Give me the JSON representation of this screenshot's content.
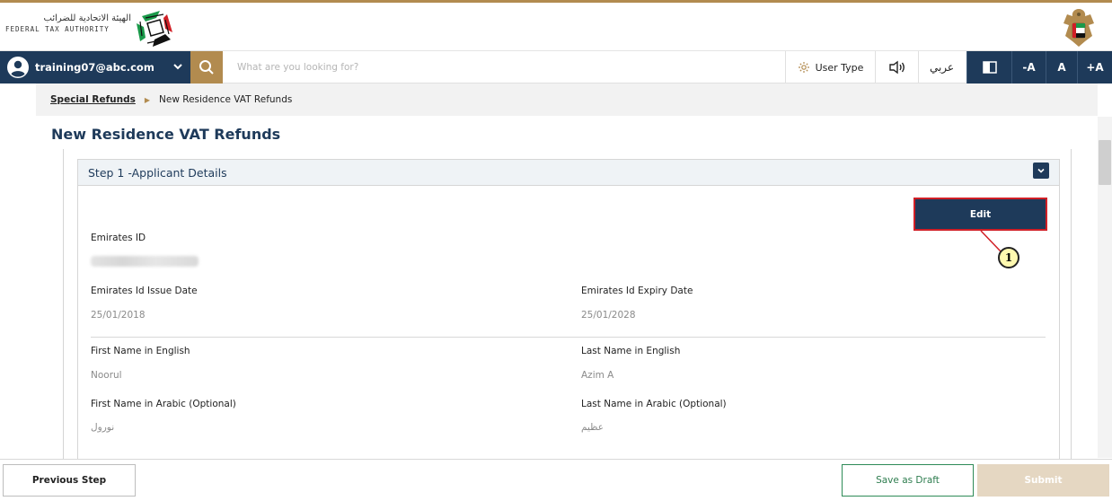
{
  "header": {
    "logo_arabic": "الهيئة الاتحادية للضرائب",
    "logo_english": "FEDERAL TAX AUTHORITY",
    "logo_icon": "fta-logo-icon",
    "emblem_icon": "uae-emblem-icon"
  },
  "navbar": {
    "user_email": "training07@abc.com",
    "search_placeholder": "What are you looking for?",
    "user_type_label": "User Type",
    "language_label": "عربي",
    "font_decrease": "-A",
    "font_normal": "A",
    "font_increase": "+A"
  },
  "breadcrumb": {
    "parent": "Special Refunds",
    "current": "New Residence VAT Refunds"
  },
  "page": {
    "title": "New Residence VAT Refunds"
  },
  "step": {
    "title": "Step 1 -Applicant Details",
    "edit_label": "Edit",
    "callout_number": "1"
  },
  "fields": {
    "emirates_id_label": "Emirates ID",
    "issue_date_label": "Emirates Id Issue Date",
    "issue_date_value": "25/01/2018",
    "expiry_date_label": "Emirates Id Expiry Date",
    "expiry_date_value": "25/01/2028",
    "first_name_en_label": "First Name in English",
    "first_name_en_value": "Noorul",
    "last_name_en_label": "Last Name in English",
    "last_name_en_value": "Azim A",
    "first_name_ar_label": "First Name in Arabic (Optional)",
    "first_name_ar_value": "نورول",
    "last_name_ar_label": "Last Name in Arabic (Optional)",
    "last_name_ar_value": "عظيم"
  },
  "footer": {
    "previous_label": "Previous Step",
    "draft_label": "Save as Draft",
    "submit_label": "Submit"
  },
  "colors": {
    "navy": "#1e3a5a",
    "gold": "#b28b4f",
    "callout_border": "#d11f26",
    "draft_green": "#2e8b57"
  }
}
